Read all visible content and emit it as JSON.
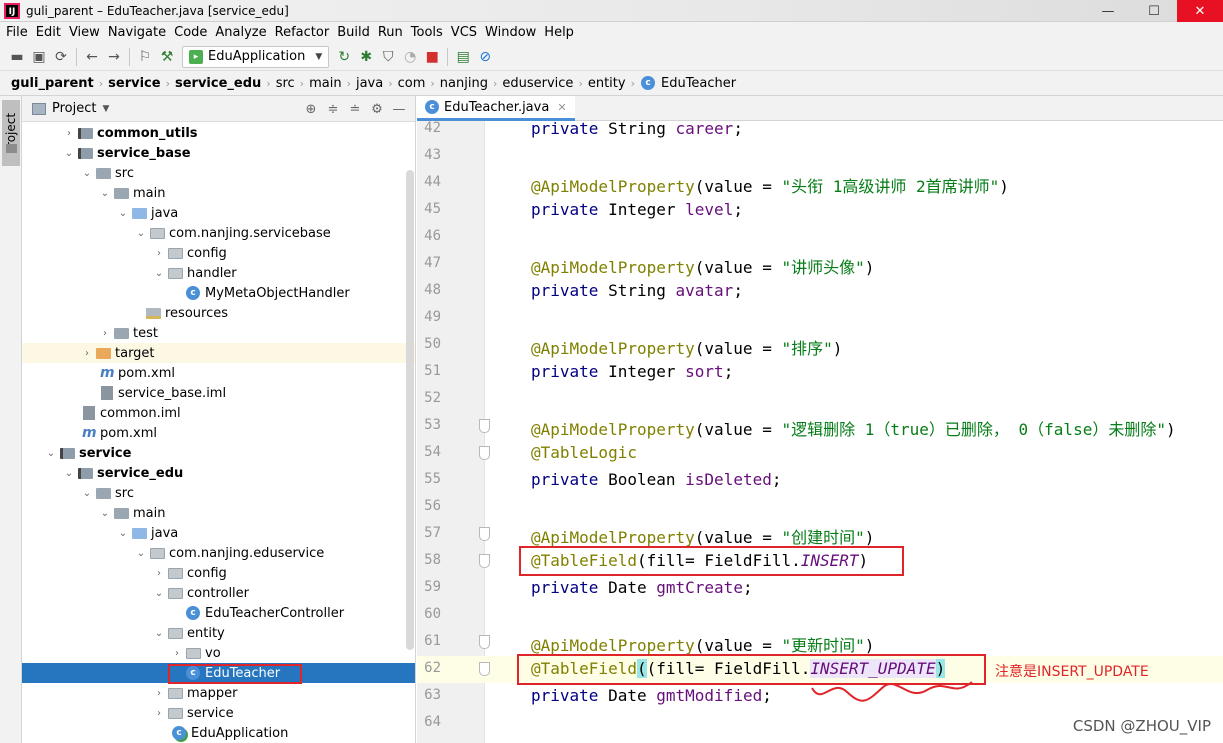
{
  "window": {
    "title": "guli_parent – EduTeacher.java [service_edu]",
    "controls": {
      "minimize": "—",
      "maximize": "☐",
      "close": "✕"
    }
  },
  "menu": [
    "File",
    "Edit",
    "View",
    "Navigate",
    "Code",
    "Analyze",
    "Refactor",
    "Build",
    "Run",
    "Tools",
    "VCS",
    "Window",
    "Help"
  ],
  "toolbar": {
    "run_config": "EduApplication"
  },
  "breadcrumb": [
    "guli_parent",
    "service",
    "service_edu",
    "src",
    "main",
    "java",
    "com",
    "nanjing",
    "eduservice",
    "entity",
    "EduTeacher"
  ],
  "sidebar": {
    "stripe_label": "Project"
  },
  "project_panel": {
    "title": "Project",
    "tree": [
      {
        "label": "common_utils",
        "bold": true
      },
      {
        "label": "service_base",
        "bold": true
      },
      {
        "label": "src"
      },
      {
        "label": "main"
      },
      {
        "label": "java"
      },
      {
        "label": "com.nanjing.servicebase"
      },
      {
        "label": "config"
      },
      {
        "label": "handler"
      },
      {
        "label": "MyMetaObjectHandler"
      },
      {
        "label": "resources"
      },
      {
        "label": "test"
      },
      {
        "label": "target"
      },
      {
        "label": "pom.xml"
      },
      {
        "label": "service_base.iml"
      },
      {
        "label": "common.iml"
      },
      {
        "label": "pom.xml"
      },
      {
        "label": "service",
        "bold": true
      },
      {
        "label": "service_edu",
        "bold": true
      },
      {
        "label": "src"
      },
      {
        "label": "main"
      },
      {
        "label": "java"
      },
      {
        "label": "com.nanjing.eduservice"
      },
      {
        "label": "config"
      },
      {
        "label": "controller"
      },
      {
        "label": "EduTeacherController"
      },
      {
        "label": "entity"
      },
      {
        "label": "vo"
      },
      {
        "label": "EduTeacher"
      },
      {
        "label": "mapper"
      },
      {
        "label": "service"
      },
      {
        "label": "EduApplication"
      }
    ]
  },
  "editor": {
    "tab": "EduTeacher.java",
    "lines": {
      "n42": "42",
      "n43": "43",
      "n44": "44",
      "n45": "45",
      "n46": "46",
      "n47": "47",
      "n48": "48",
      "n49": "49",
      "n50": "50",
      "n51": "51",
      "n52": "52",
      "n53": "53",
      "n54": "54",
      "n55": "55",
      "n56": "56",
      "n57": "57",
      "n58": "58",
      "n59": "59",
      "n60": "60",
      "n61": "61",
      "n62": "62",
      "n63": "63",
      "n64": "64"
    },
    "code": {
      "private": "private",
      "String": "String",
      "Integer": "Integer",
      "Boolean": "Boolean",
      "Date": "Date",
      "career": "career",
      "level": "level",
      "avatar": "avatar",
      "sort": "sort",
      "isDeleted": "isDeleted",
      "gmtCreate": "gmtCreate",
      "gmtModified": "gmtModified",
      "api": "@ApiModelProperty",
      "value_eq": "(value = ",
      "close_paren": ")",
      "semicolon": ";",
      "s44": "\"头衔 1高级讲师 2首席讲师\"",
      "s47": "\"讲师头像\"",
      "s50": "\"排序\"",
      "s53": "\"逻辑删除 1（true）已删除， 0（false）未删除\"",
      "s57": "\"创建时间\"",
      "s61": "\"更新时间\"",
      "tablelogic": "@TableLogic",
      "tablefield": "@TableField",
      "fill_open": "(fill= FieldFill.",
      "insert": "INSERT",
      "insert_update": "INSERT_UPDATE"
    },
    "annotation_note": "注意是INSERT_UPDATE"
  },
  "watermark": "CSDN @ZHOU_VIP"
}
